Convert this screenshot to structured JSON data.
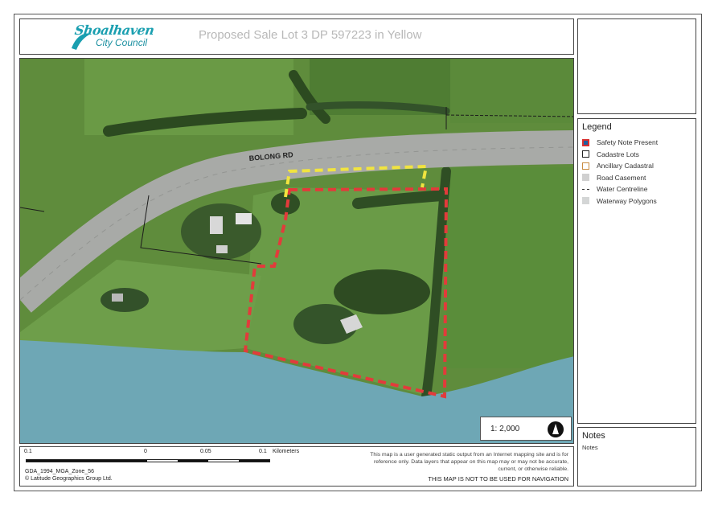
{
  "header": {
    "logo_line1": "Shoalhaven",
    "logo_line2": "City Council",
    "title": "Proposed Sale Lot 3 DP 597223 in Yellow"
  },
  "map": {
    "road_label": "BOLONG RD",
    "scale_ratio": "1: 2,000",
    "north_icon": "north-arrow-icon",
    "colors": {
      "grass": "#5c8a3a",
      "road": "#a7a9a7",
      "water": "#6fa8b6",
      "trees": "#2f4f22",
      "subject_lot": "#e63a3a",
      "sale_lot": "#f2e640"
    }
  },
  "legend": {
    "title": "Legend",
    "items": [
      {
        "label": "Safety Note Present",
        "symbol": "fill",
        "fill": "#1f5fa0",
        "stroke": "#d93030"
      },
      {
        "label": "Cadastre Lots",
        "symbol": "fill",
        "fill": "#ffffff",
        "stroke": "#222222"
      },
      {
        "label": "Ancillary Cadastral",
        "symbol": "fill",
        "fill": "#ffffff",
        "stroke": "#c88a40"
      },
      {
        "label": "Road Casement",
        "symbol": "fill",
        "fill": "#d0d0d0",
        "stroke": "#d0d0d0"
      },
      {
        "label": "Water Centreline",
        "symbol": "line",
        "fill": "#ffffff",
        "stroke": "#333333"
      },
      {
        "label": "Waterway Polygons",
        "symbol": "fill",
        "fill": "#d4d6d6",
        "stroke": "#d4d6d6"
      }
    ]
  },
  "notes": {
    "title": "Notes",
    "body": "Notes"
  },
  "footer": {
    "scale_labels": [
      "0.1",
      "0",
      "0.05",
      "0.1",
      "Kilometers"
    ],
    "projection": "GDA_1994_MGA_Zone_56",
    "copyright": "© Latitude Geographics Group Ltd.",
    "disclaimer": "This map is a user generated static output from an Internet mapping site and is for reference only. Data layers that appear on this map may or may not be accurate, current, or otherwise reliable.",
    "navigation_warning": "THIS MAP IS NOT TO BE USED FOR NAVIGATION"
  }
}
